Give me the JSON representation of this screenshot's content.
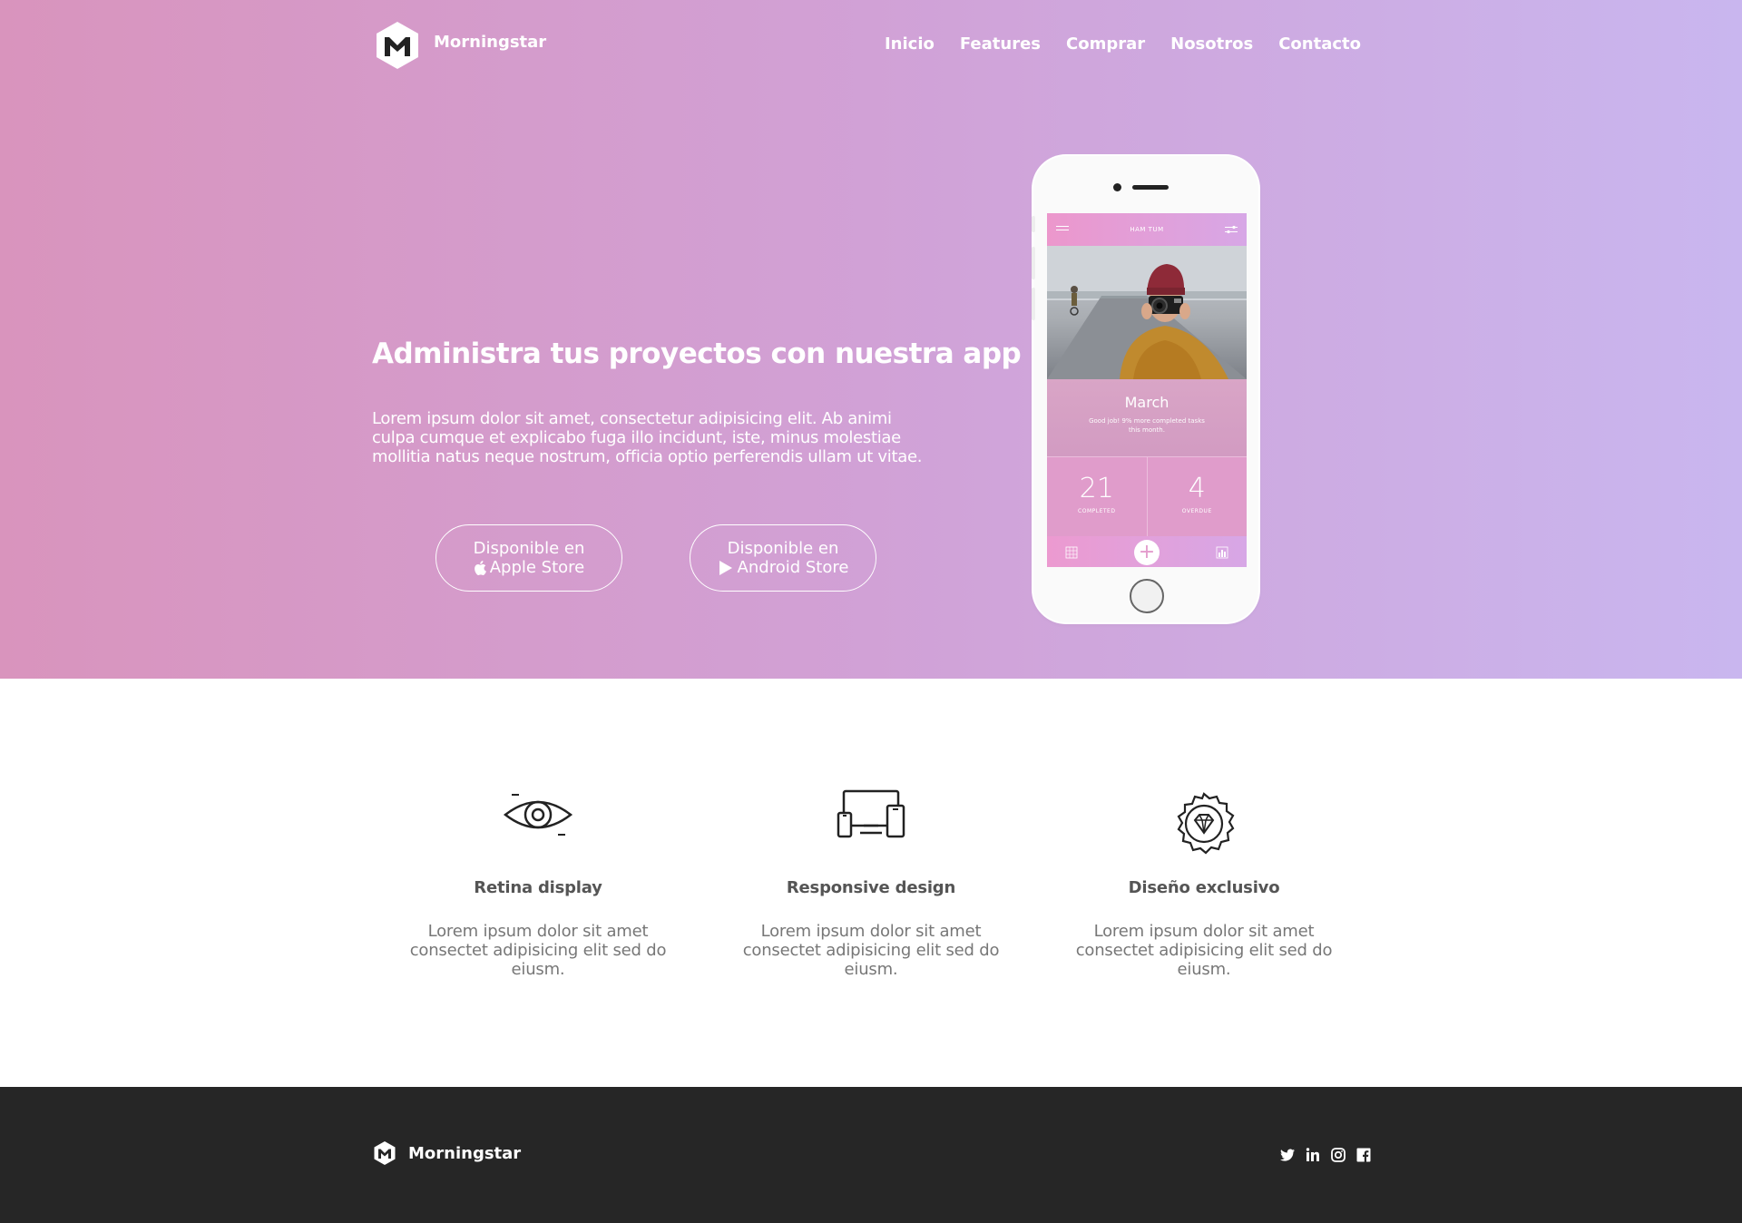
{
  "brand": {
    "name": "Morningstar"
  },
  "nav": {
    "items": [
      "Inicio",
      "Features",
      "Comprar",
      "Nosotros",
      "Contacto"
    ]
  },
  "hero": {
    "headline": "Administra tus proyectos con nuestra app",
    "lead": "Lorem ipsum dolor sit amet, consectetur adipisicing elit. Ab animi culpa cumque et explicabo fuga illo incidunt, iste, minus molestiae mollitia natus neque nostrum, officia optio perferendis ullam ut vitae.",
    "apple_button": {
      "line1": "Disponible en",
      "line2": "Apple Store"
    },
    "android_button": {
      "line1": "Disponible en",
      "line2": "Android Store"
    }
  },
  "phone_app": {
    "title": "HAM TUM",
    "month": "March",
    "subtitle": "Good job! 9% more completed tasks this month.",
    "completed_count": "21",
    "completed_label": "COMPLETED",
    "overdue_count": "4",
    "overdue_label": "OVERDUE",
    "plus": "+"
  },
  "features": [
    {
      "icon": "eye-icon",
      "title": "Retina display",
      "text": "Lorem ipsum dolor sit amet consectet adipisicing elit sed do eiusm."
    },
    {
      "icon": "devices-icon",
      "title": "Responsive design",
      "text": "Lorem ipsum dolor sit amet consectet adipisicing elit sed do eiusm."
    },
    {
      "icon": "diamond-badge-icon",
      "title": "Diseño exclusivo",
      "text": "Lorem ipsum dolor sit amet consectet adipisicing elit sed do eiusm."
    }
  ],
  "footer": {
    "brand": "Morningstar",
    "social": [
      "twitter-icon",
      "linkedin-icon",
      "instagram-icon",
      "facebook-icon"
    ]
  },
  "colors": {
    "hero_gradient_start": "#d994bd",
    "hero_gradient_end": "#c9b6ef",
    "footer_bg": "#262626"
  }
}
